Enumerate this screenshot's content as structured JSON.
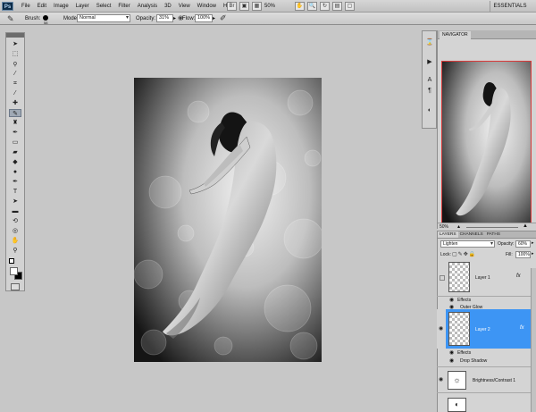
{
  "app": {
    "logo": "Ps",
    "menu": [
      "File",
      "Edit",
      "Image",
      "Layer",
      "Select",
      "Filter",
      "Analysis",
      "3D",
      "View",
      "Window",
      "Help"
    ],
    "zoom": "50%",
    "workspace": "ESSENTIALS"
  },
  "options": {
    "brush_label": "Brush:",
    "brush_size": "58",
    "mode_label": "Mode:",
    "mode_value": "Normal",
    "opacity_label": "Opacity:",
    "opacity_value": "31%",
    "flow_label": "Flow:",
    "flow_value": "100%"
  },
  "navigator": {
    "tab": "NAVIGATOR",
    "zoom": "50%"
  },
  "layers": {
    "tabs": [
      "LAYERS",
      "CHANNELS",
      "PATHS"
    ],
    "blend_mode": "Lighten",
    "opacity_label": "Opacity:",
    "opacity_value": "60%",
    "lock_label": "Lock:",
    "fill_label": "Fill:",
    "fill_value": "100%",
    "items": [
      {
        "name": "Layer 1",
        "effects_label": "Effects",
        "effect": "Outer Glow",
        "fx": "fx"
      },
      {
        "name": "Layer 2",
        "effects_label": "Effects",
        "effect": "Drop Shadow",
        "fx": "fx"
      },
      {
        "name": "Brightness/Contrast 1"
      }
    ]
  },
  "colors": {
    "selection": "#3d95f4",
    "nav_frame": "#d83a3a",
    "ps_logo": "#0e2d49"
  }
}
